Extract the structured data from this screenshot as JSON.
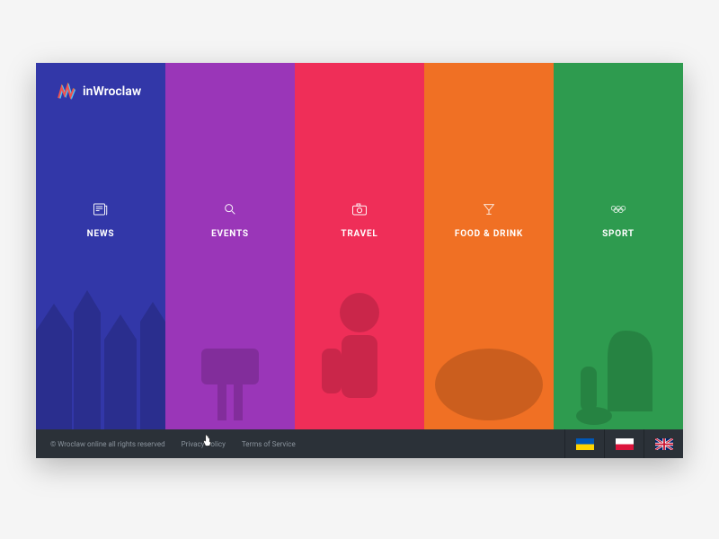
{
  "brand": {
    "name": "inWroclaw"
  },
  "columns": [
    {
      "label": "NEWS",
      "icon": "news",
      "color": "#3237a8"
    },
    {
      "label": "EVENTS",
      "icon": "search",
      "color": "#9a36b8"
    },
    {
      "label": "TRAVEL",
      "icon": "camera",
      "color": "#ef2e58"
    },
    {
      "label": "FOOD & DRINK",
      "icon": "cocktail",
      "color": "#f07024"
    },
    {
      "label": "SPORT",
      "icon": "rings",
      "color": "#2e9b4f"
    }
  ],
  "footer": {
    "copyright": "© Wroclaw online all rights reserved",
    "privacy": "Privacy Policy",
    "terms": "Terms of Service"
  },
  "languages": [
    {
      "code": "ua",
      "name": "Ukraine"
    },
    {
      "code": "pl",
      "name": "Poland"
    },
    {
      "code": "gb",
      "name": "English"
    }
  ]
}
